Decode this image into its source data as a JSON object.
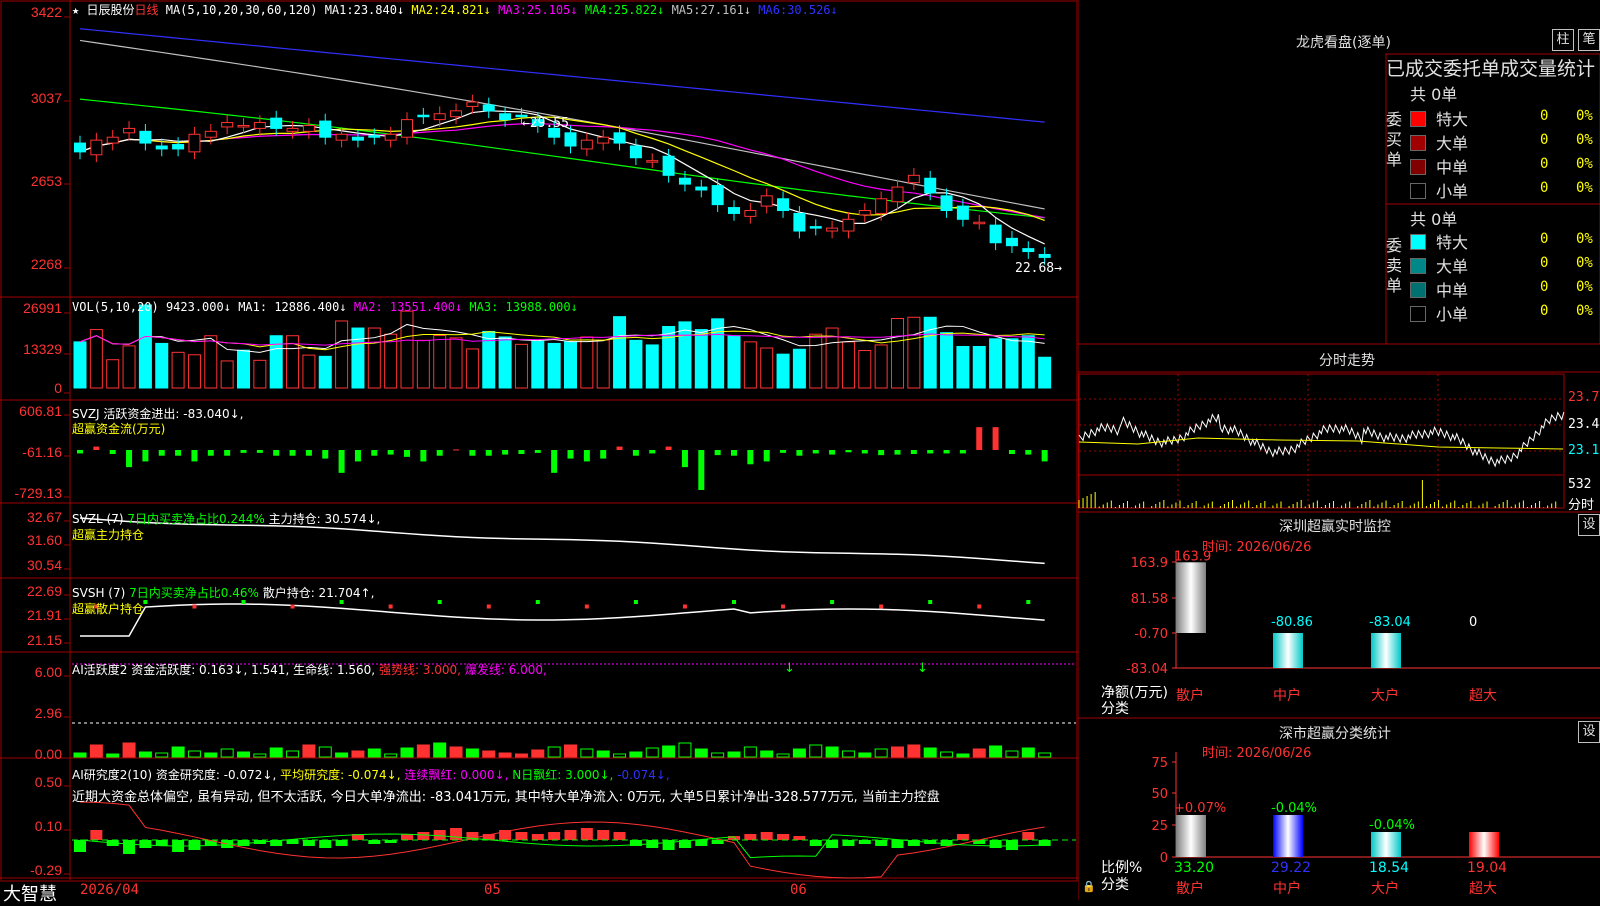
{
  "stock": {
    "name": "日辰股份",
    "period": "日线"
  },
  "colors": {
    "up": "#ff3232",
    "down": "#00ffff",
    "ma1": "#ffffff",
    "ma2": "#ffff00",
    "ma3": "#ff00ff",
    "ma4": "#00ff00",
    "ma5": "#c0c0c0",
    "ma6": "#3030ff",
    "panel_border": "#a00000"
  },
  "main_panel": {
    "ma_label": "MA(5,10,20,30,60,120)",
    "ma_values": [
      {
        "name": "MA1:",
        "value": "23.840↓"
      },
      {
        "name": "MA2:",
        "value": "24.821↓"
      },
      {
        "name": "MA3:",
        "value": "25.105↓"
      },
      {
        "name": "MA4:",
        "value": "25.822↓"
      },
      {
        "name": "MA5:",
        "value": "27.161↓"
      },
      {
        "name": "MA6:",
        "value": "30.526↓"
      }
    ],
    "y_ticks": [
      "3422",
      "3037",
      "2653",
      "2268"
    ],
    "high_label": "29.55",
    "low_label": "22.68"
  },
  "vol_panel": {
    "label": "VOL(5,10,20)",
    "value": "9423.000↓",
    "ma1": "MA1: 12886.400↓",
    "ma2": "MA2: 13551.400↓",
    "ma3": "MA3: 13988.000↓",
    "y_ticks": [
      "26991",
      "13329",
      "0"
    ]
  },
  "svzj_panel": {
    "label": "SVZJ",
    "line1": "活跃资金进出: -83.040↓,",
    "line2": "超赢资金流(万元)",
    "y_ticks": [
      "606.81",
      "-61.16",
      "-729.13"
    ]
  },
  "svzl_panel": {
    "label": "SVZL (7)",
    "pct": "7日内买卖净占比0.244%",
    "main": "主力持仓: 30.574↓,",
    "line2": "超赢主力持仓",
    "y_ticks": [
      "32.67",
      "31.60",
      "30.54"
    ]
  },
  "svsh_panel": {
    "label": "SVSH (7)",
    "pct": "7日内买卖净占比0.46%",
    "main": "散户持仓: 21.704↑,",
    "line2": "超赢散户持仓",
    "y_ticks": [
      "22.69",
      "21.91",
      "21.15"
    ]
  },
  "ai_active_panel": {
    "label": "AI活跃度2 资金活跃度: 0.163↓, 1.541,",
    "life": "生命线: 1.560,",
    "strong": "强势线: 3.000,",
    "burst": "爆发线: 6.000,",
    "y_ticks": [
      "6.00",
      "2.96",
      "0.00"
    ]
  },
  "ai_research_panel": {
    "label": "AI研究度2(10)",
    "research": "资金研究度: -0.072↓,",
    "avg": "平均研究度: -0.074↓,",
    "red": "连续飘红: 0.000↓,",
    "nred": "N日飘红: 3.000↓,",
    "last": "-0.074↓,",
    "comment": "近期大资金总体偏空, 虽有异动, 但不太活跃, 今日大单净流出: -83.041万元, 其中特大单净流入: 0万元, 大单5日累计净出-328.577万元, 当前主力控盘",
    "y_ticks": [
      "0.50",
      "0.10",
      "-0.29"
    ]
  },
  "x_axis": {
    "labels": [
      "2026/04",
      "05",
      "06"
    ],
    "brand": "大智慧"
  },
  "dragon_tiger": {
    "title": "龙虎看盘(逐单)",
    "btn1": "柱",
    "btn2": "笔",
    "header": "已成交委托单成交量统计",
    "buy": {
      "side": "委买单",
      "total": "共 0单",
      "rows": [
        {
          "label": "特大",
          "count": "0",
          "pct": "0%",
          "color": "#ff0000"
        },
        {
          "label": "大单",
          "count": "0",
          "pct": "0%",
          "color": "#a00000"
        },
        {
          "label": "中单",
          "count": "0",
          "pct": "0%",
          "color": "#800000"
        },
        {
          "label": "小单",
          "count": "0",
          "pct": "0%",
          "color": "#000000"
        }
      ]
    },
    "sell": {
      "side": "委卖单",
      "total": "共 0单",
      "rows": [
        {
          "label": "特大",
          "count": "0",
          "pct": "0%",
          "color": "#00ffff"
        },
        {
          "label": "大单",
          "count": "0",
          "pct": "0%",
          "color": "#008888"
        },
        {
          "label": "中单",
          "count": "0",
          "pct": "0%",
          "color": "#007070"
        },
        {
          "label": "小单",
          "count": "0",
          "pct": "0%",
          "color": "#000000"
        }
      ]
    }
  },
  "intraday": {
    "title": "分时走势",
    "prices": [
      "23.72",
      "23.44",
      "23.17"
    ],
    "vol": "532",
    "vol_unit": "分时"
  },
  "sz_monitor": {
    "title": "深圳超赢实时监控",
    "settings": "设",
    "time": "时间: 2026/06/26",
    "y_ticks": [
      "163.9",
      "81.58",
      "-0.70",
      "-83.04"
    ],
    "axis_label": "净额(万元)",
    "cat_label": "分类",
    "bars": [
      {
        "category": "散户",
        "value": 163.9,
        "label": "163.9"
      },
      {
        "category": "中户",
        "value": -80.86,
        "label": "-80.86"
      },
      {
        "category": "大户",
        "value": -83.04,
        "label": "-83.04"
      },
      {
        "category": "超大",
        "value": 0,
        "label": "0"
      }
    ]
  },
  "sz_class": {
    "title": "深市超赢分类统计",
    "settings": "设",
    "time": "时间: 2026/06/26",
    "y_ticks": [
      "75",
      "50",
      "25",
      "0"
    ],
    "axis_label": "比例%",
    "cat_label": "分类",
    "bars": [
      {
        "category": "散户",
        "value": 33.2,
        "label": "33.20",
        "delta": "+0.07%"
      },
      {
        "category": "中户",
        "value": 29.22,
        "label": "29.22",
        "delta": "-0.04%"
      },
      {
        "category": "大户",
        "value": 18.54,
        "label": "18.54",
        "delta": "-0.04%"
      },
      {
        "category": "超大",
        "value": 19.04,
        "label": "19.04",
        "delta": ""
      }
    ]
  },
  "chart_data": [
    {
      "type": "candlestick",
      "title": "日辰股份 日线",
      "y_ticks": [
        3422,
        3037,
        2653,
        2268
      ],
      "series": [
        {
          "name": "MA1"
        },
        {
          "name": "MA2"
        },
        {
          "name": "MA3"
        },
        {
          "name": "MA4"
        },
        {
          "name": "MA5"
        },
        {
          "name": "MA6"
        }
      ],
      "close": [
        26.4,
        26.8,
        26.9,
        27.2,
        26.7,
        26.5,
        26.5,
        27.0,
        27.1,
        27.4,
        27.3,
        27.4,
        27.2,
        27.2,
        27.3,
        26.9,
        27.0,
        26.8,
        26.9,
        27.0,
        27.5,
        27.6,
        27.7,
        27.8,
        28.1,
        27.8,
        27.5,
        27.6,
        27.3,
        26.9,
        26.6,
        26.8,
        26.9,
        26.7,
        26.2,
        26.1,
        25.6,
        25.3,
        25.1,
        24.6,
        24.3,
        24.4,
        24.9,
        24.4,
        23.7,
        23.8,
        23.8,
        24.1,
        24.4,
        24.8,
        25.2,
        25.6,
        25.0,
        24.4,
        24.1,
        24.0,
        23.3,
        23.2,
        23.0,
        22.8
      ],
      "volume": [
        15000,
        19000,
        9200,
        13700,
        26991,
        14500,
        11600,
        10800,
        17000,
        8800,
        12300,
        9000,
        17000,
        17000,
        10700,
        10300,
        21800,
        19500,
        19500,
        17500,
        25000,
        15500,
        17100,
        16300,
        12700,
        18400,
        16600,
        14200,
        15200,
        14500,
        15000,
        16600,
        15600,
        23200,
        15500,
        14000,
        20000,
        21500,
        19000,
        22500,
        17000,
        15000,
        13000,
        11000,
        12600,
        17500,
        19500,
        15000,
        12200,
        14000,
        22600,
        23000,
        23000,
        18000,
        13500,
        13500,
        16000,
        16000,
        17000,
        10000
      ]
    },
    {
      "type": "bar",
      "title": "SVZJ 超赢资金流(万元)",
      "values": [
        -60,
        60,
        -70,
        -300,
        -200,
        -100,
        -100,
        -200,
        -100,
        -100,
        -50,
        -50,
        -100,
        -100,
        -100,
        -150,
        -400,
        -200,
        -100,
        -80,
        -120,
        -200,
        -100,
        10,
        -100,
        -100,
        -80,
        -70,
        -50,
        -400,
        -150,
        -200,
        -150,
        60,
        -100,
        -60,
        60,
        -300,
        -700,
        -90,
        -100,
        -250,
        -200,
        -50,
        -100,
        -60,
        -80,
        -40,
        -60,
        -90,
        -80,
        -70,
        -60,
        -60,
        -60,
        400,
        400,
        -70,
        -80,
        -200
      ]
    },
    {
      "type": "bar",
      "title": "深圳超赢实时监控",
      "categories": [
        "散户",
        "中户",
        "大户",
        "超大"
      ],
      "values": [
        163.9,
        -80.86,
        -83.04,
        0
      ],
      "ylabel": "净额(万元)"
    },
    {
      "type": "bar",
      "title": "深市超赢分类统计",
      "categories": [
        "散户",
        "中户",
        "大户",
        "超大"
      ],
      "values": [
        33.2,
        29.22,
        18.54,
        19.04
      ],
      "ylabel": "比例%"
    }
  ]
}
